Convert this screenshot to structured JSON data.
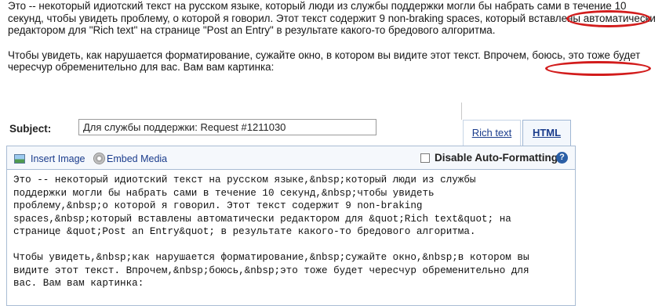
{
  "intro": {
    "paragraph1": "Это -- некоторый идиотский текст на русском языке, который люди из службы поддержки могли бы набрать сами в течение 10 секунд, чтобы увидеть проблему, о которой я говорил. Этот текст содержит 9 non-braking spaces, который вставлены автоматически редактором для \"Rich text\" на странице \"Post an Entry\" в результате какого-то бредового алгоритма.",
    "paragraph2": "Чтобы увидеть, как нарушается форматирование, сужайте окно, в котором вы видите этот текст. Впрочем, боюсь, это тоже будет чересчур обременительно для вас. Вам вам картинка:"
  },
  "annotation_color": "#d21c1c",
  "form": {
    "subject_label": "Subject:",
    "subject_value": "Для службы поддержки: Request #1211030",
    "tabs": [
      {
        "label": "Rich text",
        "active": false
      },
      {
        "label": "HTML",
        "active": true
      }
    ],
    "toolbar": {
      "insert_image": "Insert Image",
      "embed_media": "Embed Media",
      "disable_auto_formatting": "Disable Auto-Formatting",
      "disable_auto_formatting_checked": false,
      "help": "?"
    },
    "editor_text": "Это -- некоторый идиотский текст на русском языке,&nbsp;который люди из службы\nподдержки могли бы набрать сами в течение 10 секунд,&nbsp;чтобы увидеть\nпроблему,&nbsp;о которой я говорил. Этот текст содержит 9 non-braking\nspaces,&nbsp;который вставлены автоматически редактором для &quot;Rich text&quot; на\nстранице &quot;Post an Entry&quot; в результате какого-то бредового алгоритма.\n\nЧтобы увидеть,&nbsp;как нарушается форматирование,&nbsp;сужайте окно,&nbsp;в котором вы\nвидите этот текст. Впрочем,&nbsp;боюсь,&nbsp;это тоже будет чересчур обременительно для\nвас. Вам вам картинка:"
  },
  "colors": {
    "link": "#1a3c8c",
    "border": "#a9bcd4",
    "toolbar_bg": "#f5f8fc"
  }
}
